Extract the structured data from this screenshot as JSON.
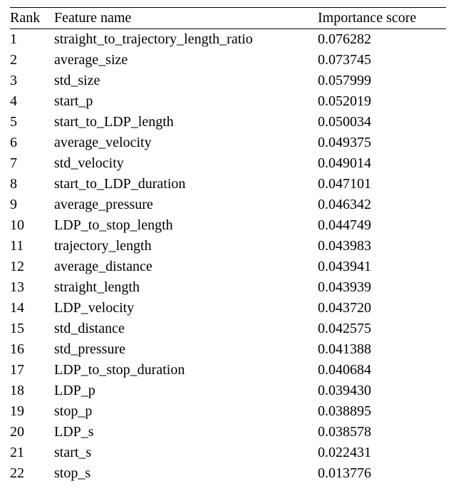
{
  "headers": {
    "rank": "Rank",
    "name": "Feature name",
    "score": "Importance score"
  },
  "chart_data": {
    "type": "table",
    "title": "",
    "columns": [
      "Rank",
      "Feature name",
      "Importance score"
    ],
    "rows": [
      {
        "rank": "1",
        "name": "straight_to_trajectory_length_ratio",
        "score": "0.076282"
      },
      {
        "rank": "2",
        "name": "average_size",
        "score": "0.073745"
      },
      {
        "rank": "3",
        "name": "std_size",
        "score": "0.057999"
      },
      {
        "rank": "4",
        "name": "start_p",
        "score": "0.052019"
      },
      {
        "rank": "5",
        "name": "start_to_LDP_length",
        "score": "0.050034"
      },
      {
        "rank": "6",
        "name": "average_velocity",
        "score": "0.049375"
      },
      {
        "rank": "7",
        "name": "std_velocity",
        "score": "0.049014"
      },
      {
        "rank": "8",
        "name": "start_to_LDP_duration",
        "score": "0.047101"
      },
      {
        "rank": "9",
        "name": "average_pressure",
        "score": "0.046342"
      },
      {
        "rank": "10",
        "name": "LDP_to_stop_length",
        "score": "0.044749"
      },
      {
        "rank": "11",
        "name": "trajectory_length",
        "score": "0.043983"
      },
      {
        "rank": "12",
        "name": "average_distance",
        "score": "0.043941"
      },
      {
        "rank": "13",
        "name": "straight_length",
        "score": "0.043939"
      },
      {
        "rank": "14",
        "name": "LDP_velocity",
        "score": "0.043720"
      },
      {
        "rank": "15",
        "name": "std_distance",
        "score": "0.042575"
      },
      {
        "rank": "16",
        "name": "std_pressure",
        "score": "0.041388"
      },
      {
        "rank": "17",
        "name": "LDP_to_stop_duration",
        "score": "0.040684"
      },
      {
        "rank": "18",
        "name": "LDP_p",
        "score": "0.039430"
      },
      {
        "rank": "19",
        "name": "stop_p",
        "score": "0.038895"
      },
      {
        "rank": "20",
        "name": "LDP_s",
        "score": "0.038578"
      },
      {
        "rank": "21",
        "name": "start_s",
        "score": "0.022431"
      },
      {
        "rank": "22",
        "name": "stop_s",
        "score": "0.013776"
      }
    ]
  }
}
